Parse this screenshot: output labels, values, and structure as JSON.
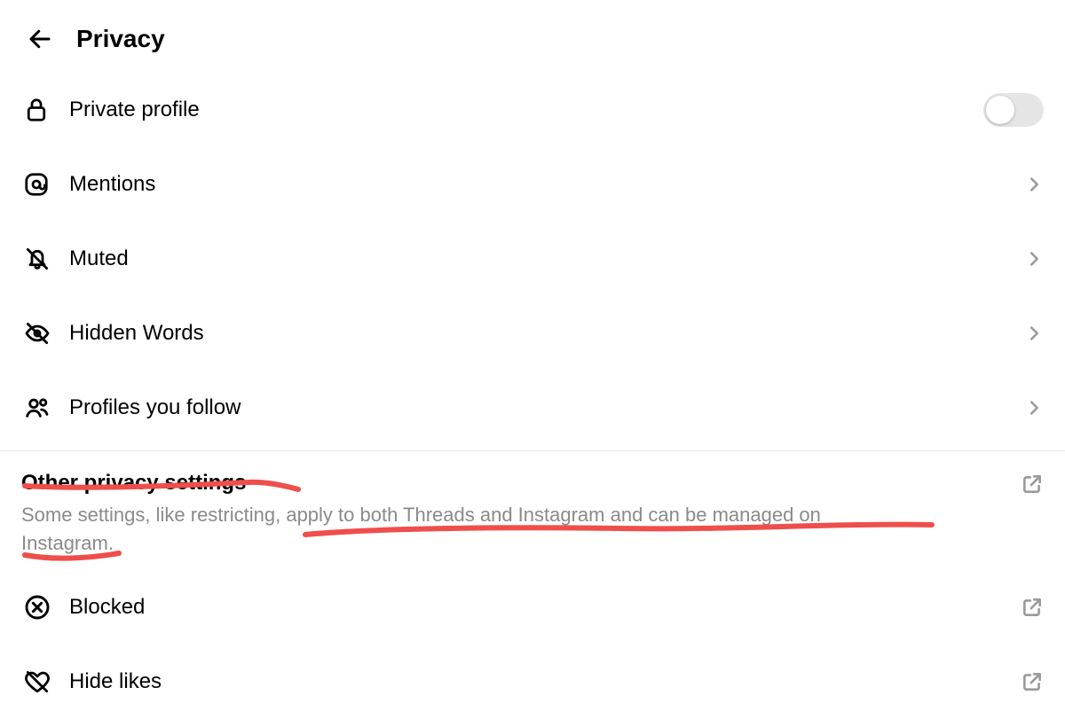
{
  "header": {
    "title": "Privacy"
  },
  "items": {
    "private_profile": "Private profile",
    "mentions": "Mentions",
    "muted": "Muted",
    "hidden_words": "Hidden Words",
    "profiles_follow": "Profiles you follow",
    "blocked": "Blocked",
    "hide_likes": "Hide likes"
  },
  "section": {
    "title": "Other privacy settings",
    "description": "Some settings, like restricting, apply to both Threads and Instagram and can be managed on Instagram."
  },
  "toggles": {
    "private_profile_on": false
  }
}
